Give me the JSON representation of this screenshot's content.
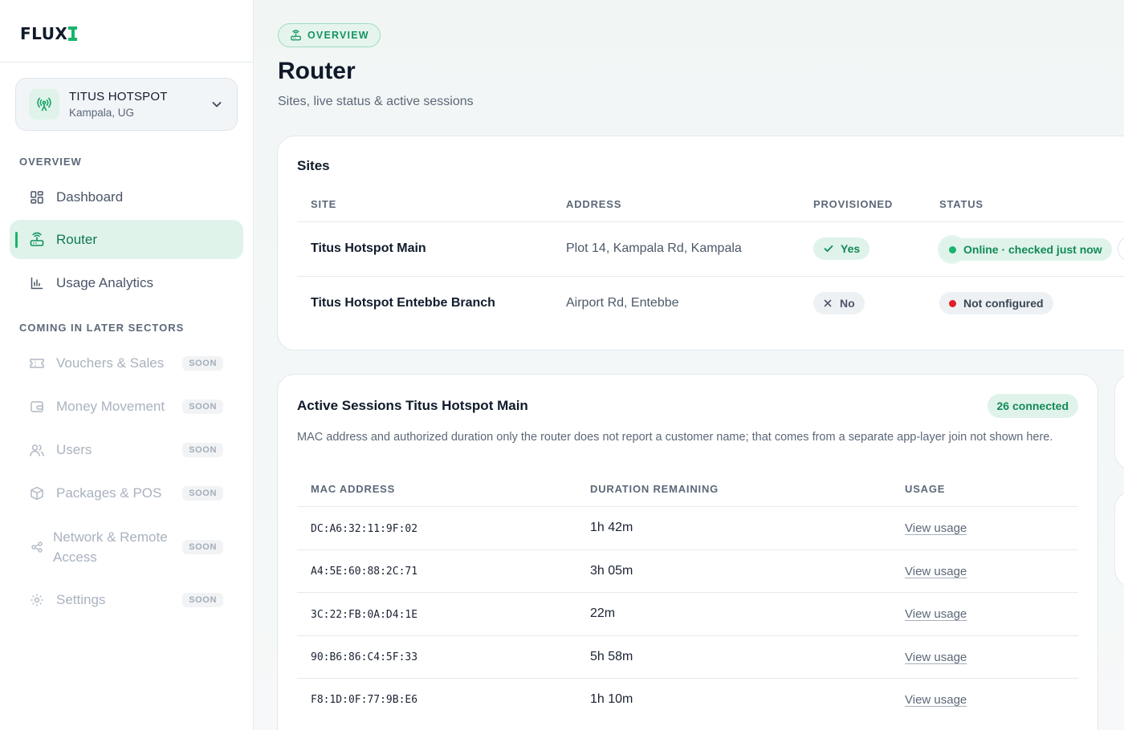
{
  "brand": {
    "logo_text": "FLUX"
  },
  "site_switcher": {
    "name": "TITUS HOTSPOT",
    "location": "Kampala, UG"
  },
  "sidebar": {
    "section_overview": "OVERVIEW",
    "section_later": "COMING IN LATER SECTORS",
    "items": [
      {
        "label": "Dashboard",
        "icon": "dashboard-icon"
      },
      {
        "label": "Router",
        "icon": "router-icon",
        "active": true
      },
      {
        "label": "Usage Analytics",
        "icon": "bar-chart-icon"
      }
    ],
    "later_items": [
      {
        "label": "Vouchers & Sales",
        "badge": "SOON",
        "icon": "ticket-icon"
      },
      {
        "label": "Money Movement",
        "badge": "SOON",
        "icon": "wallet-icon"
      },
      {
        "label": "Users",
        "badge": "SOON",
        "icon": "users-icon"
      },
      {
        "label": "Packages & POS",
        "badge": "SOON",
        "icon": "package-icon"
      },
      {
        "label_line1": "Network & Remote",
        "label_line2": "Access",
        "badge": "SOON",
        "icon": "share-icon"
      },
      {
        "label": "Settings",
        "badge": "SOON",
        "icon": "gear-icon"
      }
    ]
  },
  "header": {
    "pill": "OVERVIEW",
    "title": "Router",
    "subtitle": "Sites, live status & active sessions"
  },
  "sites": {
    "title": "Sites",
    "columns": [
      "SITE",
      "ADDRESS",
      "PROVISIONED",
      "STATUS"
    ],
    "rows": [
      {
        "site": "Titus Hotspot Main",
        "address": "Plot 14, Kampala Rd, Kampala",
        "provisioned": "Yes",
        "status": "Online · checked just now"
      },
      {
        "site": "Titus Hotspot Entebbe Branch",
        "address": "Airport Rd, Entebbe",
        "provisioned": "No",
        "status": "Not configured"
      }
    ]
  },
  "sessions": {
    "title": "Active Sessions Titus Hotspot Main",
    "count": "26 connected",
    "description": "MAC address and authorized duration only the router does not report a customer name; that comes from a separate app-layer join not shown here.",
    "columns": [
      "MAC ADDRESS",
      "DURATION REMAINING",
      "USAGE"
    ],
    "rows": [
      {
        "mac": "DC:A6:32:11:9F:02",
        "duration": "1h 42m",
        "usage": "View usage"
      },
      {
        "mac": "A4:5E:60:88:2C:71",
        "duration": "3h 05m",
        "usage": "View usage"
      },
      {
        "mac": "3C:22:FB:0A:D4:1E",
        "duration": "22m",
        "usage": "View usage"
      },
      {
        "mac": "90:B6:86:C4:5F:33",
        "duration": "5h 58m",
        "usage": "View usage"
      },
      {
        "mac": "F8:1D:0F:77:9B:E6",
        "duration": "1h 10m",
        "usage": "View usage"
      }
    ]
  },
  "colors": {
    "accent": "#19b46e",
    "accent_bg": "#dff3ea",
    "danger": "#e11d2a"
  }
}
